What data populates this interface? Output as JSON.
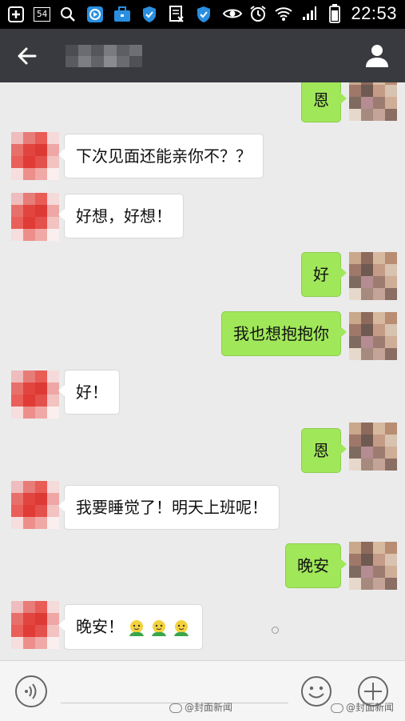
{
  "status_bar": {
    "badge": "54",
    "time": "22:53",
    "icons": [
      "add-icon",
      "notification-badge",
      "search-icon",
      "app-icon",
      "briefcase-icon",
      "shield-icon",
      "doc-icon",
      "shield-icon",
      "eye-icon",
      "alarm-icon",
      "wifi-icon",
      "signal-icon",
      "battery-icon"
    ]
  },
  "header": {
    "back_icon": "back-arrow-icon",
    "contact_icon": "person-icon"
  },
  "messages": [
    {
      "side": "out",
      "text": "恩"
    },
    {
      "side": "in",
      "text": "下次见面还能亲你不？？"
    },
    {
      "side": "in",
      "text": "好想，好想！"
    },
    {
      "side": "out",
      "text": "好"
    },
    {
      "side": "out",
      "text": "我也想抱抱你"
    },
    {
      "side": "in",
      "text": "好！"
    },
    {
      "side": "out",
      "text": "恩"
    },
    {
      "side": "in",
      "text": "我要睡觉了！明天上班呢！"
    },
    {
      "side": "out",
      "text": "晚安"
    },
    {
      "side": "in",
      "text": "晚安！",
      "emoji_count": 3
    }
  ],
  "bottom_bar": {
    "voice_icon": "voice-icon",
    "emoji_icon": "smiley-icon",
    "plus_icon": "plus-icon",
    "watermark_1": "@封面新闻",
    "watermark_2": "@封面新闻"
  },
  "colors": {
    "outgoing_bubble": "#a0e75a",
    "incoming_bubble": "#ffffff",
    "header": "#393a3f",
    "chat_background": "#ebebeb"
  }
}
